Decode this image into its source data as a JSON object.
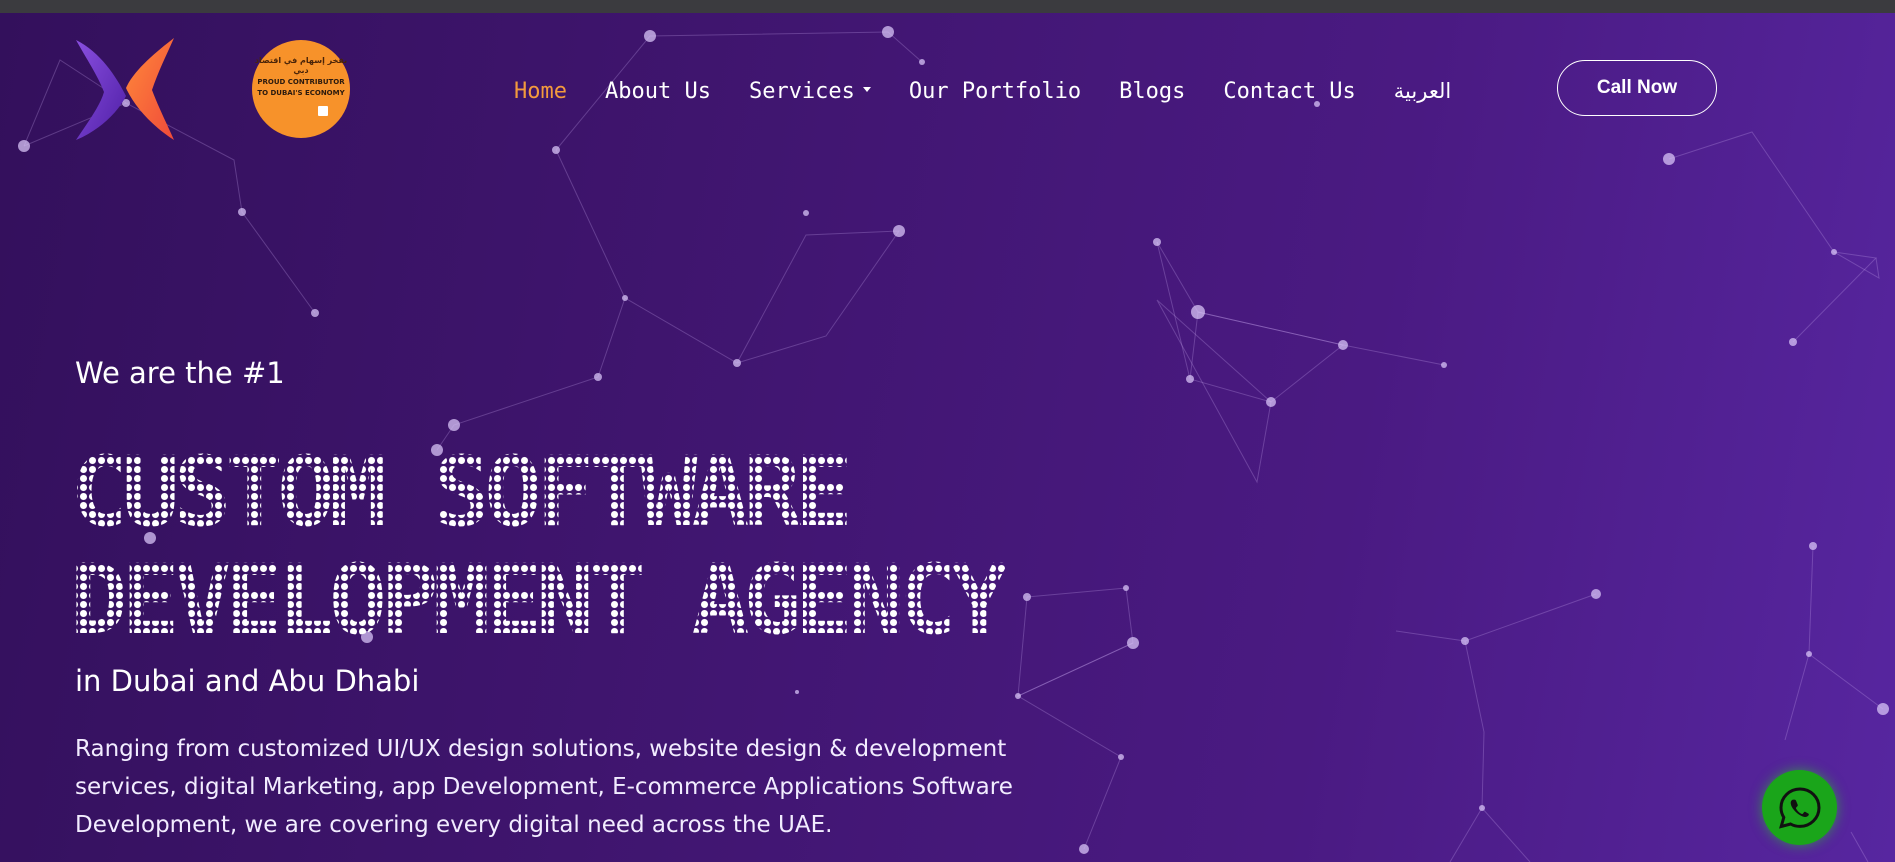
{
  "header": {
    "brand_icon": "xavor-x-logo",
    "badge": {
      "icon": "proud-contributor-badge",
      "arabic_text": "بفخر إسهام في اقتصاد دبي",
      "line1": "PROUD CONTRIBUTOR",
      "line2": "TO DUBAI'S ECONOMY",
      "color": "#f7922a"
    },
    "nav": {
      "items": [
        {
          "label": "Home",
          "active": true
        },
        {
          "label": "About Us"
        },
        {
          "label": "Services",
          "has_dropdown": true
        },
        {
          "label": "Our Portfolio"
        },
        {
          "label": "Blogs"
        },
        {
          "label": "Contact Us"
        },
        {
          "label": "العربية"
        }
      ],
      "active_color": "#f39a3d"
    },
    "call_button": "Call Now"
  },
  "hero": {
    "pre_title": "We are the #1",
    "title_line1": "CUSTOM SOFTWARE",
    "title_line2": "DEVELOPMENT AGENCY",
    "subtitle": "in Dubai and Abu Dhabi",
    "description": "Ranging from customized UI/UX design solutions, website design & development services, digital Marketing, app Development, E-commerce Applications Software Development, we are covering every digital need across the UAE."
  },
  "floating": {
    "whatsapp_icon": "whatsapp-icon",
    "whatsapp_color": "#1aa51a"
  },
  "colors": {
    "background_start": "#33105c",
    "background_end": "#5726a0"
  }
}
